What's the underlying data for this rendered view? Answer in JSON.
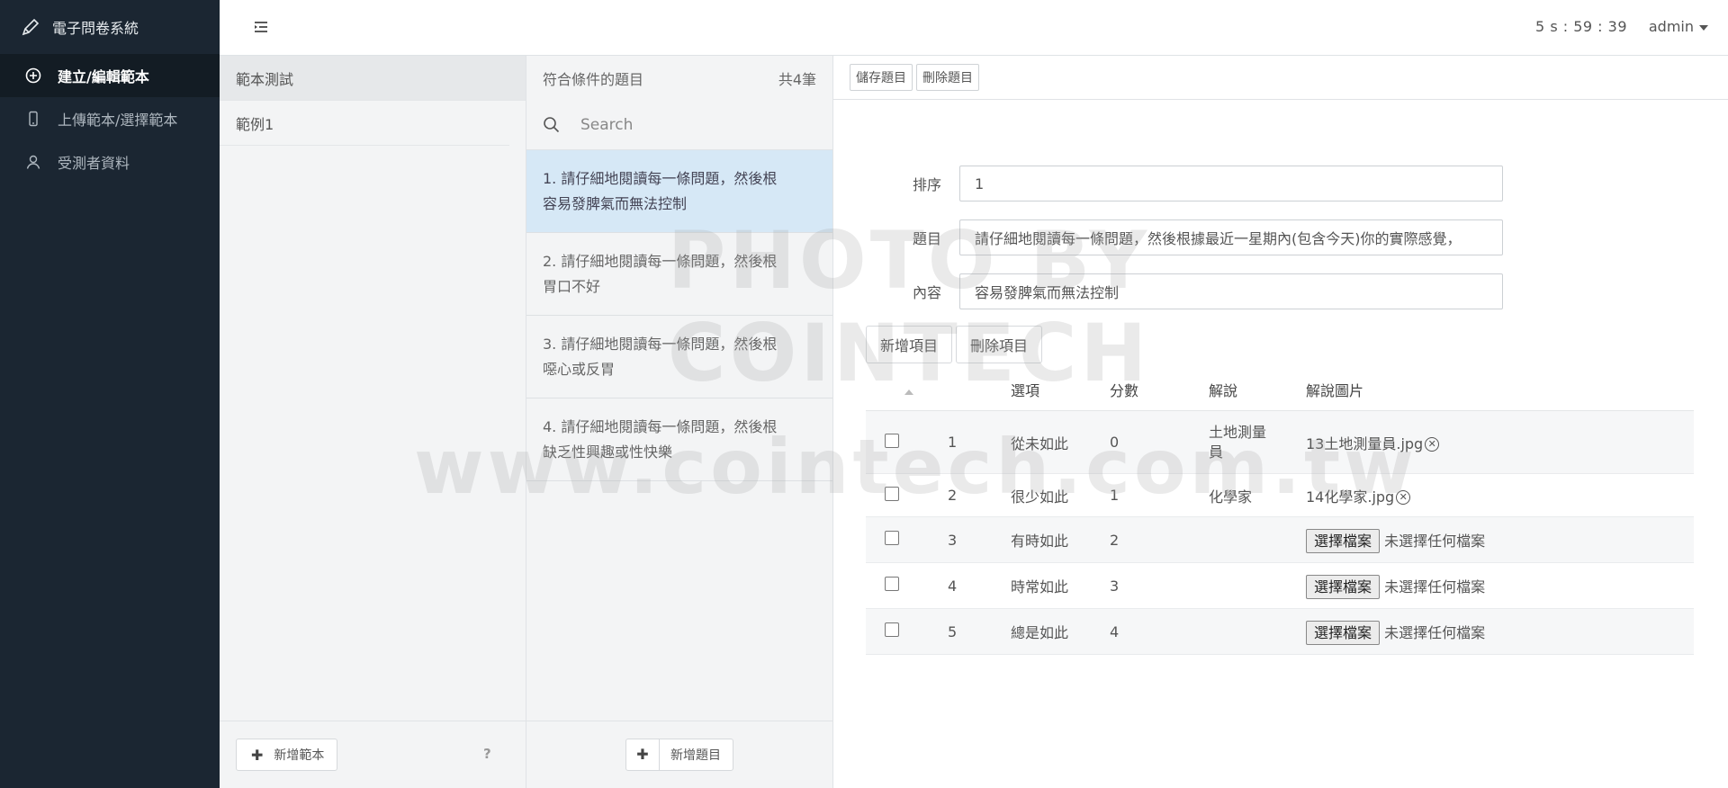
{
  "app": {
    "title": "電子問卷系統"
  },
  "sidebar": {
    "items": [
      {
        "label": "建立/編輯範本",
        "icon": "plus-circle-icon",
        "active": true
      },
      {
        "label": "上傳範本/選擇範本",
        "icon": "phone-icon",
        "active": false
      },
      {
        "label": "受測者資料",
        "icon": "user-icon",
        "active": false
      }
    ]
  },
  "topbar": {
    "timer": "5 s : 59 : 39",
    "user": "admin"
  },
  "templates": {
    "items": [
      "範本測試",
      "範例1"
    ],
    "add_label": "新增範本",
    "help": "?"
  },
  "questions": {
    "header": "符合條件的題目",
    "count": "共4筆",
    "search_placeholder": "Search",
    "items": [
      {
        "line1": "1. 請仔細地閱讀每一條問題，然後根",
        "line2": "容易發脾氣而無法控制"
      },
      {
        "line1": "2. 請仔細地閱讀每一條問題，然後根",
        "line2": "胃口不好"
      },
      {
        "line1": "3. 請仔細地閱讀每一條問題，然後根",
        "line2": "噁心或反胃"
      },
      {
        "line1": "4. 請仔細地閱讀每一條問題，然後根",
        "line2": "缺乏性興趣或性快樂"
      }
    ],
    "add_label": "新增題目"
  },
  "editor": {
    "save_label": "儲存題目",
    "delete_label": "刪除題目",
    "fields": {
      "order_label": "排序",
      "order_value": "1",
      "title_label": "題目",
      "title_value": "請仔細地閱讀每一條問題，然後根據最近一星期內(包含今天)你的實際感覺，",
      "content_label": "內容",
      "content_value": "容易發脾氣而無法控制"
    },
    "add_option_label": "新增項目",
    "delete_option_label": "刪除項目",
    "table": {
      "headers": {
        "option": "選項",
        "score": "分數",
        "explain": "解說",
        "image": "解說圖片"
      },
      "rows": [
        {
          "no": "1",
          "option": "從未如此",
          "score": "0",
          "explain": "土地測量員",
          "image": "13土地測量員.jpg"
        },
        {
          "no": "2",
          "option": "很少如此",
          "score": "1",
          "explain": "化學家",
          "image": "14化學家.jpg"
        },
        {
          "no": "3",
          "option": "有時如此",
          "score": "2",
          "explain": "",
          "image": ""
        },
        {
          "no": "4",
          "option": "時常如此",
          "score": "3",
          "explain": "",
          "image": ""
        },
        {
          "no": "5",
          "option": "總是如此",
          "score": "4",
          "explain": "",
          "image": ""
        }
      ],
      "file_button": "選擇檔案",
      "no_file": "未選擇任何檔案"
    }
  },
  "watermark": {
    "line1": "PHOTO BY COINTECH",
    "line2": "www.cointech.com.tw"
  }
}
